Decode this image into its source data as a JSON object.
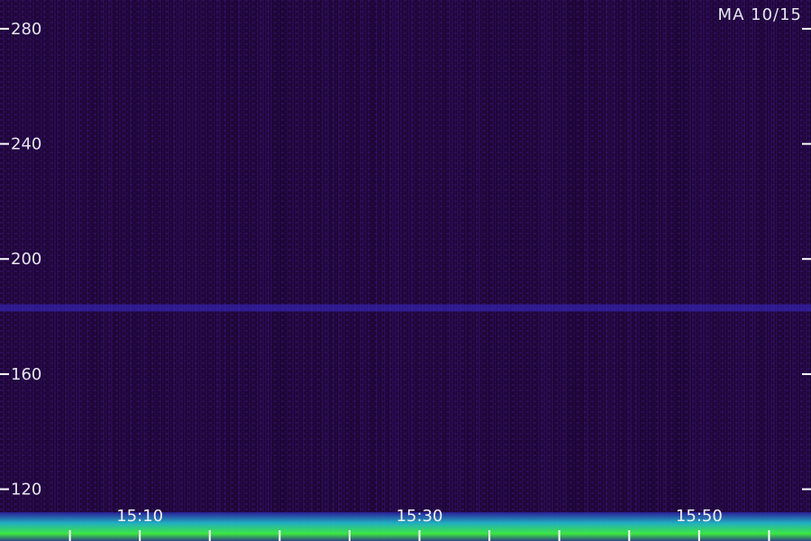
{
  "chart_data": {
    "type": "heatmap",
    "title": "MA 10/15",
    "y_ticks": [
      280,
      240,
      200,
      160,
      120
    ],
    "ylim": [
      102,
      290
    ],
    "x_labels": [
      "15:10",
      "15:30",
      "15:50"
    ],
    "xlim_minutes": [
      0,
      58
    ],
    "x_label_minutes": [
      10,
      30,
      50
    ],
    "x_minor_tick_minutes": [
      5,
      10,
      15,
      20,
      25,
      30,
      35,
      40,
      45,
      50,
      55
    ],
    "features": [
      {
        "name": "horizontal band",
        "y": 183,
        "intensity": 0.55
      },
      {
        "name": "low-band noise floor",
        "y_range": [
          102,
          112
        ],
        "intensity": 0.9
      }
    ],
    "colors": {
      "background": "#120320",
      "low": "#2a0a55",
      "mid": "#3b2cd0",
      "high": "#40ff40",
      "cyan": "#20d0e0",
      "axis": "#ffffff"
    }
  }
}
